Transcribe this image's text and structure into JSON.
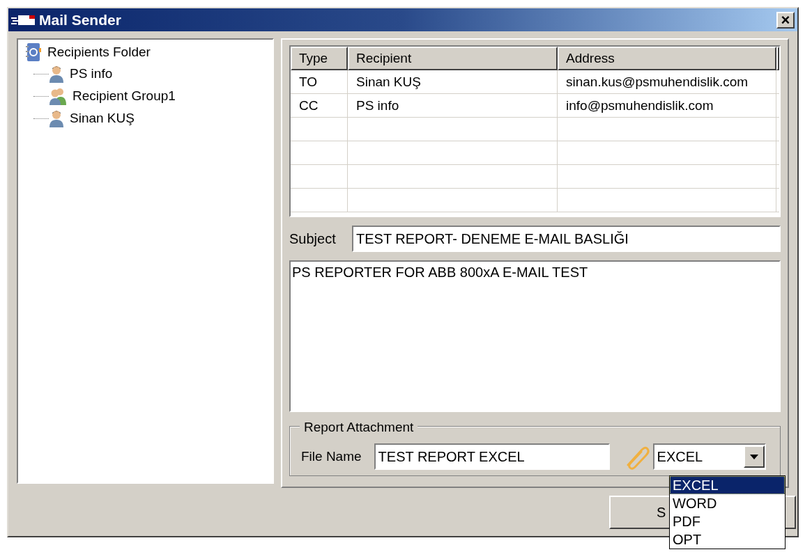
{
  "window": {
    "title": "Mail Sender",
    "close": "×"
  },
  "tree": {
    "label": "Recipients Folder",
    "kind": "folder",
    "children": [
      {
        "label": "PS info",
        "kind": "person"
      },
      {
        "label": "Recipient Group1",
        "kind": "group"
      },
      {
        "label": "Sinan KUŞ",
        "kind": "person"
      }
    ]
  },
  "table": {
    "columns": [
      "Type",
      "Recipient",
      "Address"
    ],
    "rows": [
      {
        "cells": [
          "TO",
          "Sinan KUŞ",
          "sinan.kus@psmuhendislik.com"
        ]
      },
      {
        "cells": [
          "CC",
          "PS info",
          "info@psmuhendislik.com"
        ]
      }
    ]
  },
  "subject": {
    "label": "Subject",
    "value": "TEST REPORT- DENEME E-MAIL BASLIĞI"
  },
  "body": {
    "value": "PS REPORTER FOR ABB 800xA E-MAIL TEST"
  },
  "attachment": {
    "legend": "Report Attachment",
    "file_label": "File Name",
    "file_value": "TEST REPORT EXCEL",
    "format": "EXCEL",
    "options": [
      {
        "label": "EXCEL",
        "selected": true
      },
      {
        "label": "WORD",
        "selected": false
      },
      {
        "label": "PDF",
        "selected": false
      },
      {
        "label": "OPT",
        "selected": false
      }
    ]
  },
  "send_button": {
    "label": "S"
  }
}
